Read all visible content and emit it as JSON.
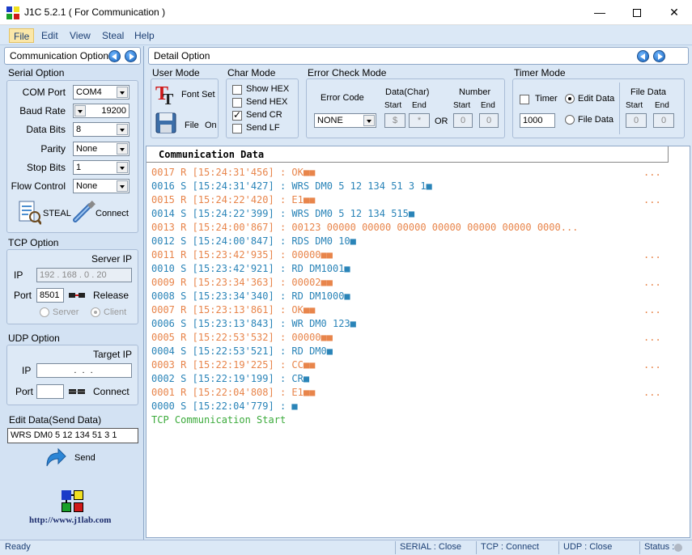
{
  "window": {
    "title": "J1C 5.2.1 ( For Communication )"
  },
  "menu": {
    "file": "File",
    "edit": "Edit",
    "view": "View",
    "steal": "Steal",
    "help": "Help"
  },
  "left": {
    "header": "Communication Option",
    "serial": {
      "section": "Serial Option",
      "com_port_label": "COM Port",
      "com_port": "COM4",
      "baud_rate_label": "Baud Rate",
      "baud_rate": "19200",
      "data_bits_label": "Data Bits",
      "data_bits": "8",
      "parity_label": "Parity",
      "parity": "None",
      "stop_bits_label": "Stop Bits",
      "stop_bits": "1",
      "flow_control_label": "Flow Control",
      "flow_control": "None",
      "steal_label": "STEAL",
      "connect_label": "Connect"
    },
    "tcp": {
      "section": "TCP Option",
      "server_ip_label": "Server IP",
      "ip_label": "IP",
      "ip": "192 . 168 .  0  . 20",
      "port_label": "Port",
      "port": "8501",
      "release_label": "Release",
      "server_label": "Server",
      "client_label": "Client"
    },
    "udp": {
      "section": "UDP Option",
      "target_ip_label": "Target IP",
      "ip_label": "IP",
      "ip": ".        .        .",
      "port_label": "Port",
      "port": "",
      "connect_label": "Connect"
    },
    "edit": {
      "section": "Edit Data(Send Data)",
      "value": "WRS DM0 5 12 134 51 3 1",
      "send_label": "Send"
    },
    "logo_url": "http://www.j1lab.com"
  },
  "detail": {
    "header": "Detail Option",
    "user_mode": {
      "title": "User Mode",
      "font_set": "Font Set",
      "file": "File",
      "on": "On"
    },
    "char_mode": {
      "title": "Char Mode",
      "show_hex": "Show HEX",
      "send_hex": "Send HEX",
      "send_cr": "Send CR",
      "send_lf": "Send LF"
    },
    "error_check": {
      "title": "Error Check Mode",
      "error_code_label": "Error Code",
      "error_code": "NONE",
      "data_char_label": "Data(Char)",
      "start_label": "Start",
      "end_label": "End",
      "data_start": "$",
      "data_end": "*",
      "or_label": "OR",
      "number_label": "Number",
      "num_start_label": "Start",
      "num_end_label": "End",
      "num_start": "0",
      "num_end": "0"
    },
    "timer": {
      "title": "Timer Mode",
      "timer_label": "Timer",
      "edit_data_label": "Edit Data",
      "file_data_radio_label": "File Data",
      "interval": "1000",
      "file_data_label": "File Data",
      "start_label": "Start",
      "end_label": "End",
      "start": "0",
      "end": "0"
    }
  },
  "log": {
    "header": "Communication Data",
    "lines": [
      {
        "text": "0017 R [15:24:31'456] : OK■■",
        "dir": "R",
        "dots": "..."
      },
      {
        "text": "0016 S [15:24:31'427] : WRS DM0 5 12 134 51 3 1■",
        "dir": "S",
        "dots": ""
      },
      {
        "text": "0015 R [15:24:22'420] : E1■■",
        "dir": "R",
        "dots": "..."
      },
      {
        "text": "0014 S [15:24:22'399] : WRS DM0 5 12 134 515■",
        "dir": "S",
        "dots": ""
      },
      {
        "text": "0013 R [15:24:00'867] : 00123 00000 00000 00000 00000 00000 00000 0000...",
        "dir": "R",
        "dots": ""
      },
      {
        "text": "0012 S [15:24:00'847] : RDS DM0 10■",
        "dir": "S",
        "dots": ""
      },
      {
        "text": "0011 R [15:23:42'935] : 00000■■",
        "dir": "R",
        "dots": "..."
      },
      {
        "text": "0010 S [15:23:42'921] : RD DM1001■",
        "dir": "S",
        "dots": ""
      },
      {
        "text": "0009 R [15:23:34'363] : 00002■■",
        "dir": "R",
        "dots": "..."
      },
      {
        "text": "0008 S [15:23:34'340] : RD DM1000■",
        "dir": "S",
        "dots": ""
      },
      {
        "text": "0007 R [15:23:13'861] : OK■■",
        "dir": "R",
        "dots": "..."
      },
      {
        "text": "0006 S [15:23:13'843] : WR DM0 123■",
        "dir": "S",
        "dots": ""
      },
      {
        "text": "0005 R [15:22:53'532] : 00000■■",
        "dir": "R",
        "dots": "..."
      },
      {
        "text": "0004 S [15:22:53'521] : RD DM0■",
        "dir": "S",
        "dots": ""
      },
      {
        "text": "0003 R [15:22:19'225] : CC■■",
        "dir": "R",
        "dots": "..."
      },
      {
        "text": "0002 S [15:22:19'199] : CR■",
        "dir": "S",
        "dots": ""
      },
      {
        "text": "0001 R [15:22:04'808] : E1■■",
        "dir": "R",
        "dots": "..."
      },
      {
        "text": "0000 S [15:22:04'779] : ■",
        "dir": "S",
        "dots": ""
      },
      {
        "text": "TCP Communication Start",
        "dir": "start",
        "dots": ""
      }
    ]
  },
  "status": {
    "ready": "Ready",
    "serial": "SERIAL : Close",
    "tcp": "TCP : Connect",
    "udp": "UDP : Close",
    "status": "Status :"
  }
}
